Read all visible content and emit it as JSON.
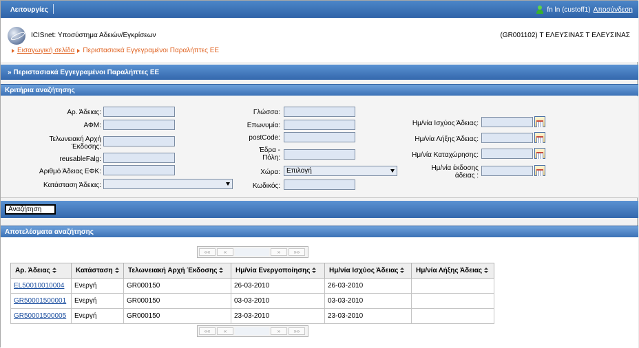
{
  "topbar": {
    "menu_label": "Λειτουργίες",
    "user_label": "fn ln (custoff1)",
    "logout_label": "Αποσύνδεση"
  },
  "header": {
    "app_title": "ICISnet: Υποσύστημα Αδειών/Εγκρίσεων",
    "office": "(GR001102) Τ ΕΛΕΥΣΙΝΑΣ Τ ΕΛΕΥΣΙΝΑΣ",
    "breadcrumb": {
      "home": "Εισαγωγική σελίδα",
      "current": "Περιστασιακά Εγγεγραμένοι Παραλήπτες ΕΕ"
    }
  },
  "page_title": "» Περιστασιακά Εγγεγραμένοι Παραλήπτες ΕΕ",
  "criteria": {
    "title": "Κριτήρια αναζήτησης",
    "col1": {
      "license_no": "Αρ. Άδειας:",
      "afm": "ΑΦΜ:",
      "customs_office_1": "Τελωνειακή Αρχή",
      "customs_office_2": "Έκδοσης:",
      "reusable": "reusableFalg:",
      "efk_no": "Αριθμό Άδειας ΕΦΚ:",
      "status": "Κατάσταση Άδειας:"
    },
    "col2": {
      "language": "Γλώσσα:",
      "name": "Επωνυμία:",
      "postcode": "postCode:",
      "city_1": "Έδρα -",
      "city_2": "Πόλη:",
      "country": "Χώρα:",
      "country_value": "Επιλογή",
      "code": "Κωδικός:"
    },
    "col3": {
      "valid_from": "Ημ/νία Ισχύος Άδειας:",
      "valid_to": "Ημ/νία Λήξης Άδειας:",
      "registered": "Ημ/νία Καταχώρησης:",
      "issued_1": "Ημ/νία έκδοσης",
      "issued_2": "άδειας :"
    },
    "search_button": "Αναζήτηση"
  },
  "results": {
    "title": "Αποτελέσματα αναζήτησης",
    "pager": {
      "first": "««",
      "prev": "«",
      "next": "»",
      "last": "»»"
    },
    "columns": [
      "Αρ. Άδειας",
      "Κατάσταση",
      "Τελωνειακή Αρχή Έκδοσης",
      "Ημ/νία Ενεργοποίησης",
      "Ημ/νία Ισχύος Άδειας",
      "Ημ/νία Λήξης Άδειας"
    ],
    "rows": [
      [
        "EL50010010004",
        "Ενεργή",
        "GR000150",
        "26-03-2010",
        "26-03-2010",
        ""
      ],
      [
        "GR50001500001",
        "Ενεργή",
        "GR000150",
        "03-03-2010",
        "03-03-2010",
        ""
      ],
      [
        "GR50001500005",
        "Ενεργή",
        "GR000150",
        "23-03-2010",
        "23-03-2010",
        ""
      ]
    ]
  }
}
